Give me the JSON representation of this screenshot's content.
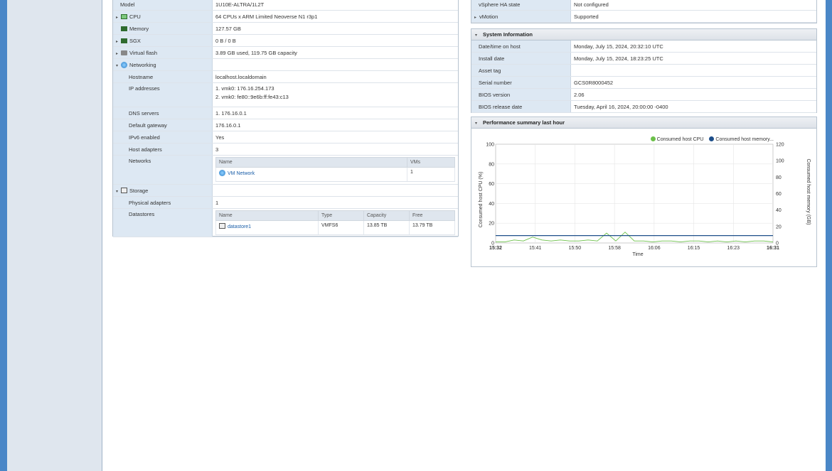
{
  "hardware": {
    "rows": [
      {
        "label": "Model",
        "value": "1U10E-ALTRA/1L2T"
      },
      {
        "label": "CPU",
        "value": "64 CPUs x ARM Limited Neoverse N1 r3p1",
        "icon": "cpu-icon"
      },
      {
        "label": "Memory",
        "value": "127.57 GB",
        "icon": "memory-icon"
      },
      {
        "label": "SGX",
        "value": "0 B / 0 B",
        "icon": "sgx-icon"
      },
      {
        "label": "Virtual flash",
        "value": "3.89 GB used, 119.75 GB capacity",
        "icon": "flash-icon"
      },
      {
        "label": "Networking",
        "value": "",
        "icon": "network-icon"
      },
      {
        "label": "Hostname",
        "value": "localhost.localdomain"
      },
      {
        "label": "IP addresses",
        "value": "1. vmk0: 176.16.254.173",
        "value2": "2. vmk0: fe80::9e6b:ff:fe43:c13"
      },
      {
        "label": "DNS servers",
        "value": "1. 176.16.0.1"
      },
      {
        "label": "Default gateway",
        "value": "176.16.0.1"
      },
      {
        "label": "IPv6 enabled",
        "value": "Yes"
      },
      {
        "label": "Host adapters",
        "value": "3"
      },
      {
        "label": "Networks",
        "value": ""
      },
      {
        "label": "Storage",
        "value": "",
        "icon": "storage-icon"
      },
      {
        "label": "Physical adapters",
        "value": "1"
      },
      {
        "label": "Datastores",
        "value": ""
      }
    ],
    "networks_table": {
      "headers": [
        "Name",
        "VMs"
      ],
      "rows": [
        {
          "name": "VM Network",
          "vms": "1"
        }
      ]
    },
    "datastores_table": {
      "headers": [
        "Name",
        "Type",
        "Capacity",
        "Free"
      ],
      "rows": [
        {
          "name": "datastore1",
          "type": "VMFS6",
          "capacity": "13.85 TB",
          "free": "13.79 TB"
        }
      ]
    }
  },
  "ha": {
    "rows": [
      {
        "label": "vSphere HA state",
        "value": "Not configured"
      },
      {
        "label": "vMotion",
        "value": "Supported"
      }
    ]
  },
  "system_info": {
    "title": "System Information",
    "rows": [
      {
        "label": "Date/time on host",
        "value": "Monday, July 15, 2024, 20:32:10 UTC"
      },
      {
        "label": "Install date",
        "value": "Monday, July 15, 2024, 18:23:25 UTC"
      },
      {
        "label": "Asset tag",
        "value": ""
      },
      {
        "label": "Serial number",
        "value": "GCS0R8000452"
      },
      {
        "label": "BIOS version",
        "value": "2.06"
      },
      {
        "label": "BIOS release date",
        "value": "Tuesday, April 16, 2024, 20:00:00 -0400"
      }
    ]
  },
  "performance": {
    "title": "Performance summary last hour"
  },
  "chart_data": {
    "type": "line",
    "xlabel": "Time",
    "ylabel": "Consumed host CPU (%)",
    "ylabel_right": "Consumed host memory (GB)",
    "x": [
      "15:32",
      "15:41",
      "15:50",
      "15:58",
      "16:06",
      "16:15",
      "16:23",
      "16:31"
    ],
    "y_ticks": [
      "0",
      "20",
      "40",
      "60",
      "80",
      "100"
    ],
    "y2_ticks": [
      "0",
      "20",
      "40",
      "60",
      "80",
      "100",
      "120"
    ],
    "ylim": [
      0,
      100
    ],
    "y2lim": [
      0,
      120
    ],
    "legend_position": "top-right",
    "series": [
      {
        "name": "Consumed host CPU",
        "color": "#6cc04a",
        "axis": "left",
        "values": [
          1,
          1,
          3,
          2,
          6,
          3,
          2,
          3,
          2,
          2,
          3,
          2,
          10,
          2,
          11,
          2,
          2,
          1,
          2,
          2,
          1,
          2,
          2,
          1,
          2,
          1,
          2,
          1,
          2,
          2,
          1
        ]
      },
      {
        "name": "Consumed host memory...",
        "color": "#1d4e89",
        "axis": "right",
        "values": [
          9,
          9,
          9,
          9,
          9,
          9,
          9,
          9,
          9,
          9,
          9,
          9,
          9,
          9,
          9,
          9,
          9,
          9,
          9,
          9,
          9,
          9,
          9,
          9,
          9,
          9,
          9,
          9,
          9,
          9,
          9
        ]
      }
    ]
  }
}
